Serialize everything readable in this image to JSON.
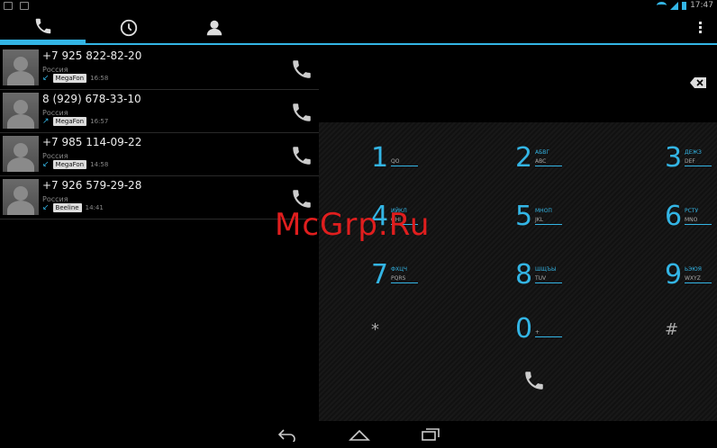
{
  "status": {
    "time": "17:47"
  },
  "tabs": [
    {
      "name": "phone-tab"
    },
    {
      "name": "recent-tab"
    },
    {
      "name": "contacts-tab"
    }
  ],
  "calls": [
    {
      "number": "+7 925 822-82-20",
      "location": "Россия",
      "direction": "incoming",
      "arrow": "↙",
      "carrier": "MegaFon",
      "time": "16:58"
    },
    {
      "number": "8 (929) 678-33-10",
      "location": "Россия",
      "direction": "outgoing",
      "arrow": "↗",
      "carrier": "MegaFon",
      "time": "16:57"
    },
    {
      "number": "+7 985 114-09-22",
      "location": "Россия",
      "direction": "incoming",
      "arrow": "↙",
      "carrier": "MegaFon",
      "time": "14:58"
    },
    {
      "number": "+7 926 579-29-28",
      "location": "Россия",
      "direction": "incoming",
      "arrow": "↙",
      "carrier": "Beeline",
      "time": "14:41"
    }
  ],
  "keys": [
    {
      "digit": "1",
      "top": "",
      "bottom": "QO"
    },
    {
      "digit": "2",
      "top": "АБВГ",
      "bottom": "ABC"
    },
    {
      "digit": "3",
      "top": "ДЕЖЗ",
      "bottom": "DEF"
    },
    {
      "digit": "4",
      "top": "ИЙКЛ",
      "bottom": "GHI"
    },
    {
      "digit": "5",
      "top": "МНОП",
      "bottom": "JKL"
    },
    {
      "digit": "6",
      "top": "РСТУ",
      "bottom": "MNO"
    },
    {
      "digit": "7",
      "top": "ФХЦЧ",
      "bottom": "PQRS"
    },
    {
      "digit": "8",
      "top": "ШЩЪЫ",
      "bottom": "TUV"
    },
    {
      "digit": "9",
      "top": "ЬЭЮЯ",
      "bottom": "WXYZ"
    },
    {
      "digit": "*",
      "top": "",
      "bottom": ""
    },
    {
      "digit": "0",
      "top": "",
      "bottom": "+"
    },
    {
      "digit": "#",
      "top": "",
      "bottom": ""
    }
  ],
  "watermark": "McGrp.Ru",
  "colors": {
    "accent": "#33b5e5",
    "watermark": "#e01e1e"
  }
}
